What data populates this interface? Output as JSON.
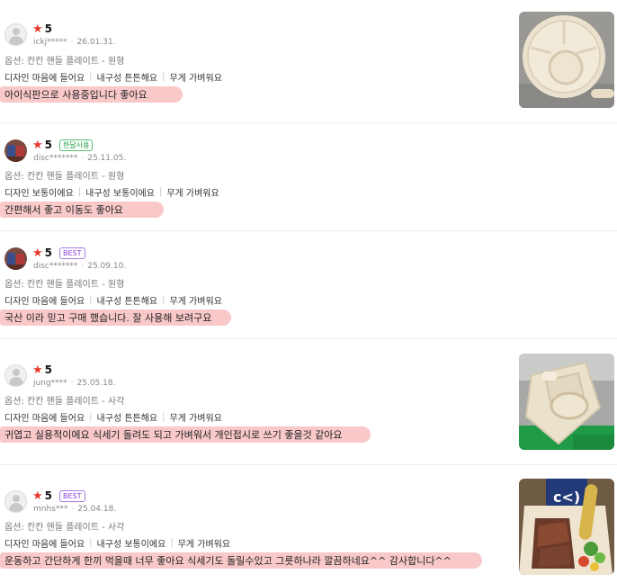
{
  "reviews": [
    {
      "score": "5",
      "badge": "",
      "user": "ickj*****",
      "date": "26.01.31.",
      "option": "옵션: 칸칸 핸들 플레이트 - 원형",
      "tags": [
        "디자인 마음에 들어요",
        "내구성 튼튼해요",
        "무게 가벼워요"
      ],
      "text": "아이식판으로 사용중입니다 좋아요",
      "avatar": "default-avatar",
      "photo": "round-plate-photo"
    },
    {
      "score": "5",
      "badge": "한달사용",
      "user": "disc*******",
      "date": "25.11.05.",
      "option": "옵션: 칸칸 핸들 플레이트 - 원형",
      "tags": [
        "디자인 보통이에요",
        "내구성 보통이에요",
        "무게 가벼워요"
      ],
      "text": "간편해서 좋고 이동도 좋아요",
      "avatar": "photo-avatar"
    },
    {
      "score": "5",
      "badge": "BEST",
      "user": "disc*******",
      "date": "25.09.10.",
      "option": "옵션: 칸칸 핸들 플레이트 - 원형",
      "tags": [
        "디자인 마음에 들어요",
        "내구성 튼튼해요",
        "무게 가벼워요"
      ],
      "text": "국산 이라 믿고 구매 했습니다. 잘 사용해 보려구요",
      "avatar": "photo-avatar"
    },
    {
      "score": "5",
      "badge": "",
      "user": "jung****",
      "date": "25.05.18.",
      "option": "옵션: 칸칸 핸들 플레이트 - 사각",
      "tags": [
        "디자인 마음에 들어요",
        "내구성 튼튼해요",
        "무게 가벼워요"
      ],
      "text": "귀엽고 실용적이에요 식세기 돌려도 되고 가벼워서 개인접시로 쓰기 좋을것 같아요",
      "avatar": "default-avatar",
      "photo": "square-plate-photo"
    },
    {
      "score": "5",
      "badge": "BEST",
      "user": "mnhs***",
      "date": "25.04.18.",
      "option": "옵션: 칸칸 핸들 플레이트 - 사각",
      "tags": [
        "디자인 마음에 들어요",
        "내구성 보통이에요",
        "무게 가벼워요"
      ],
      "text": "운동하고 간단하게 한끼 먹을때 너무 좋아요 식세기도 돌릴수있고 그릇하나라 깔끔하네요^^ 감사합니다^^",
      "avatar": "default-avatar",
      "photo": "food-plate-photo"
    }
  ],
  "colors": {
    "star": "#e8362b",
    "highlight": "#f9c9ca",
    "badge_green": "#1e9b3e",
    "badge_purple": "#8a3ed6"
  }
}
